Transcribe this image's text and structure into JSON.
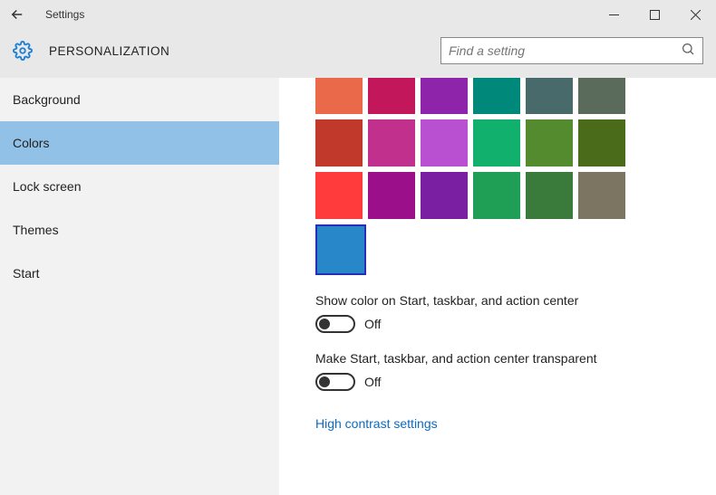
{
  "window": {
    "title": "Settings"
  },
  "header": {
    "title": "PERSONALIZATION",
    "search_placeholder": "Find a setting"
  },
  "sidebar": {
    "items": [
      {
        "label": "Background",
        "active": false
      },
      {
        "label": "Colors",
        "active": true
      },
      {
        "label": "Lock screen",
        "active": false
      },
      {
        "label": "Themes",
        "active": false
      },
      {
        "label": "Start",
        "active": false
      }
    ]
  },
  "colors": {
    "rows": [
      [
        "#e9694a",
        "#c2185b",
        "#8e24aa",
        "#00897b",
        "#486a6a",
        "#5b6b5b"
      ],
      [
        "#c0392b",
        "#c2308e",
        "#b94fd1",
        "#11b06c",
        "#558b2f",
        "#4a6b1a"
      ],
      [
        "#ff3b3b",
        "#9c0f8b",
        "#7b1fa2",
        "#1f9e55",
        "#3a7a3a",
        "#7c7561"
      ]
    ],
    "selected": "#2787c9"
  },
  "settings": {
    "show_color": {
      "label": "Show color on Start, taskbar, and action center",
      "state": "Off"
    },
    "transparency": {
      "label": "Make Start, taskbar, and action center transparent",
      "state": "Off"
    },
    "high_contrast_link": "High contrast settings"
  }
}
